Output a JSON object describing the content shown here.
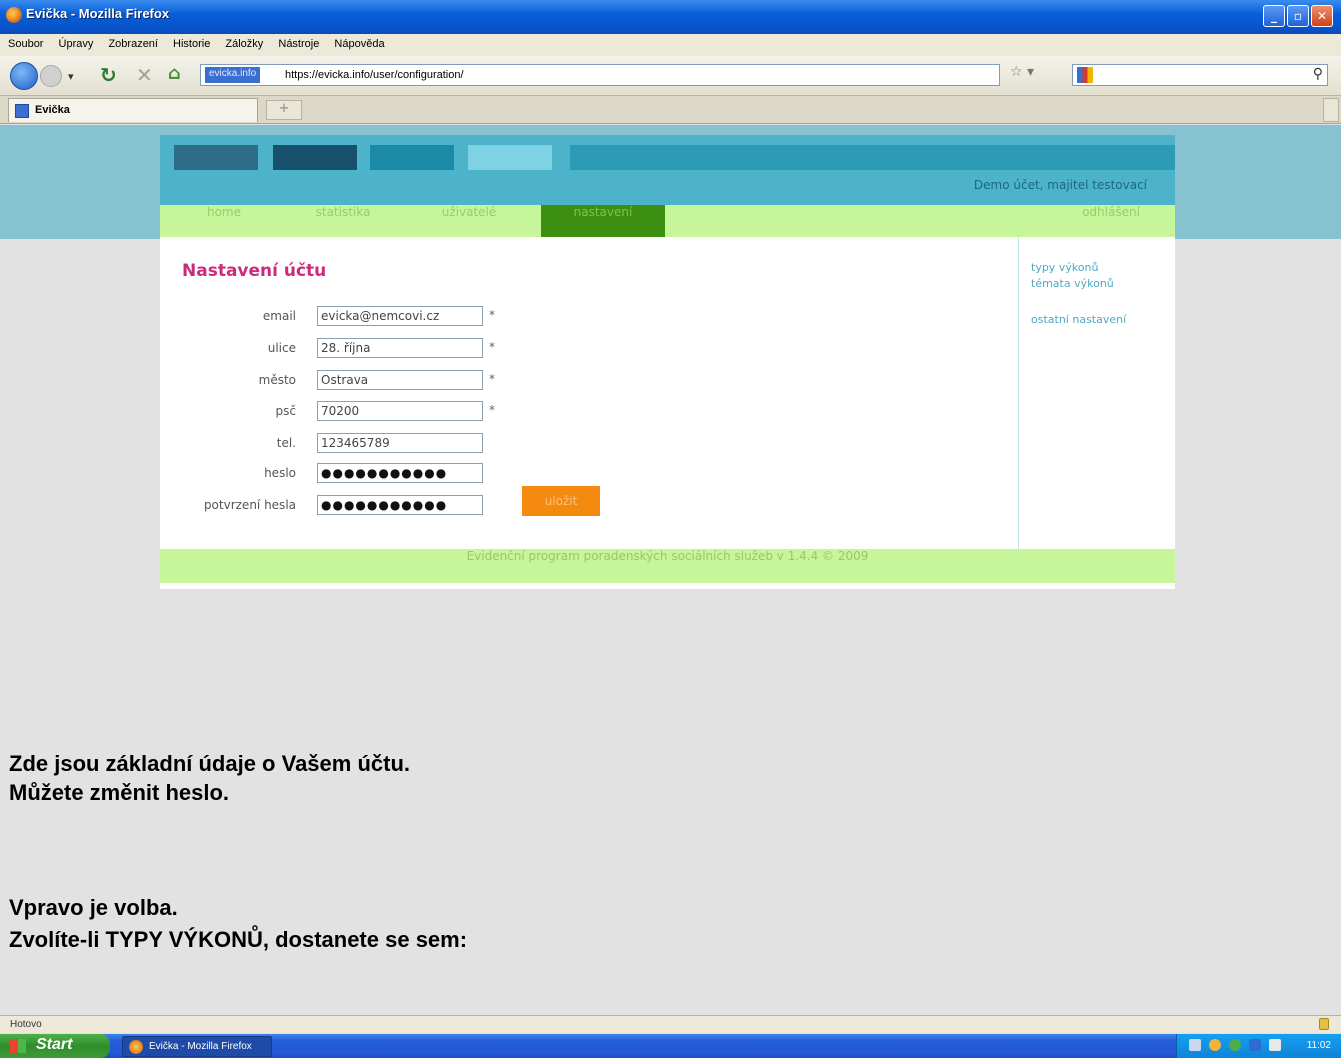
{
  "window": {
    "title": "Evička - Mozilla Firefox"
  },
  "menubar": [
    "Soubor",
    "Úpravy",
    "Zobrazení",
    "Historie",
    "Záložky",
    "Nástroje",
    "Nápověda"
  ],
  "navbar": {
    "site_badge": "evicka.info",
    "url": "https://evicka.info/user/configuration/"
  },
  "tab": {
    "label": "Evička"
  },
  "site": {
    "demo_account": "Demo účet, majitel testovací",
    "menu": {
      "home": "home",
      "statistika": "statistika",
      "uzivatele": "uživatelé",
      "nastaveni": "nastavení",
      "odhlaseni": "odhlášení"
    },
    "heading": "Nastavení účtu",
    "form": {
      "email": {
        "label": "email",
        "value": "evicka@nemcovi.cz",
        "required": "*"
      },
      "ulice": {
        "label": "ulice",
        "value": "28. října",
        "required": "*"
      },
      "mesto": {
        "label": "město",
        "value": "Ostrava",
        "required": "*"
      },
      "psc": {
        "label": "psč",
        "value": "70200",
        "required": "*"
      },
      "tel": {
        "label": "tel.",
        "value": "123465789"
      },
      "heslo": {
        "label": "heslo",
        "value": "●●●●●●●●●●●"
      },
      "potvrzeni": {
        "label": "potvrzení hesla",
        "value": "●●●●●●●●●●●"
      },
      "save_label": "uložit"
    },
    "sidebar": {
      "typy": "typy výkonů",
      "temata": "témata výkonů",
      "ostatni": "ostatní nastavení"
    },
    "footer": "Evidenční program poradenských sociálních služeb v 1.4.4 © 2009"
  },
  "caption": {
    "line1": "Zde jsou základní údaje o Vašem účtu.",
    "line2": "Můžete změnit heslo.",
    "line3": "Vpravo je volba.",
    "line4": "Zvolíte-li TYPY VÝKONŮ, dostanete se sem:"
  },
  "statusbar": {
    "text": "Hotovo"
  },
  "taskbar": {
    "start": "Start",
    "task": "Evička - Mozilla Firefox",
    "clock": "11:02"
  }
}
